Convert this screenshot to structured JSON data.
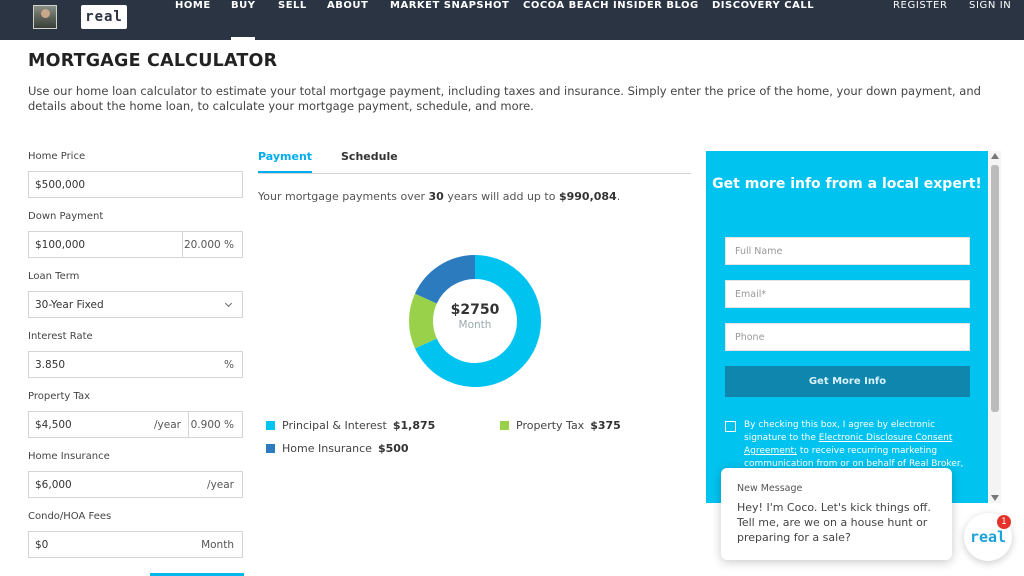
{
  "nav": {
    "logo": "real",
    "items": [
      "HOME",
      "BUY",
      "SELL",
      "ABOUT",
      "MARKET SNAPSHOT",
      "COCOA BEACH INSIDER BLOG",
      "DISCOVERY CALL"
    ],
    "active": "BUY",
    "register": "REGISTER",
    "sign_in": "SIGN IN"
  },
  "page": {
    "title": "MORTGAGE CALCULATOR",
    "intro": "Use our home loan calculator to estimate your total mortgage payment, including taxes and insurance. Simply enter the price of the home, your down payment, and details about the home loan, to calculate your mortgage payment, schedule, and more."
  },
  "form": {
    "home_price": {
      "label": "Home Price",
      "value": "$500,000"
    },
    "down_payment": {
      "label": "Down Payment",
      "value": "$100,000",
      "percent": "20.000 %"
    },
    "loan_term": {
      "label": "Loan Term",
      "value": "30-Year Fixed"
    },
    "interest_rate": {
      "label": "Interest Rate",
      "value": "3.850",
      "unit": "%"
    },
    "property_tax": {
      "label": "Property Tax",
      "value": "$4,500",
      "period": "/year",
      "percent": "0.900 %"
    },
    "home_insurance": {
      "label": "Home Insurance",
      "value": "$6,000",
      "period": "/year"
    },
    "hoa": {
      "label": "Condo/HOA Fees",
      "value": "$0",
      "period": "Month"
    }
  },
  "tabs": {
    "payment": "Payment",
    "schedule": "Schedule",
    "active": "Payment"
  },
  "summary": {
    "prefix": "Your mortgage payments over",
    "years": "30",
    "mid": "years will add up to",
    "total": "$990,084",
    "end": "."
  },
  "donut": {
    "amount": "$2750",
    "period": "Month"
  },
  "chart_data": {
    "type": "pie",
    "center_label": "$2750",
    "slices": [
      {
        "name": "Principal & Interest",
        "label": "$1,875",
        "value": 1875,
        "color": "#00c3ef"
      },
      {
        "name": "Property Tax",
        "label": "$375",
        "value": 375,
        "color": "#9ad14b"
      },
      {
        "name": "Home Insurance",
        "label": "$500",
        "value": 500,
        "color": "#2c7bbf"
      }
    ]
  },
  "cta": {
    "title": "Get more info from a local expert!",
    "full_name_placeholder": "Full Name",
    "email_placeholder": "Email*",
    "phone_placeholder": "Phone",
    "button": "Get More Info",
    "consent_part1": "By checking this box, I agree by electronic signature to the ",
    "consent_link": "Electronic Disclosure Consent Agreement;",
    "consent_part2": " to receive recurring marketing communication from or on behalf of Real Broker,"
  },
  "chat": {
    "title": "New Message",
    "message": "Hey! I'm Coco. Let's kick things off. Tell me, are we on a house hunt or preparing for a sale?",
    "badge": "1",
    "logo": "real"
  }
}
